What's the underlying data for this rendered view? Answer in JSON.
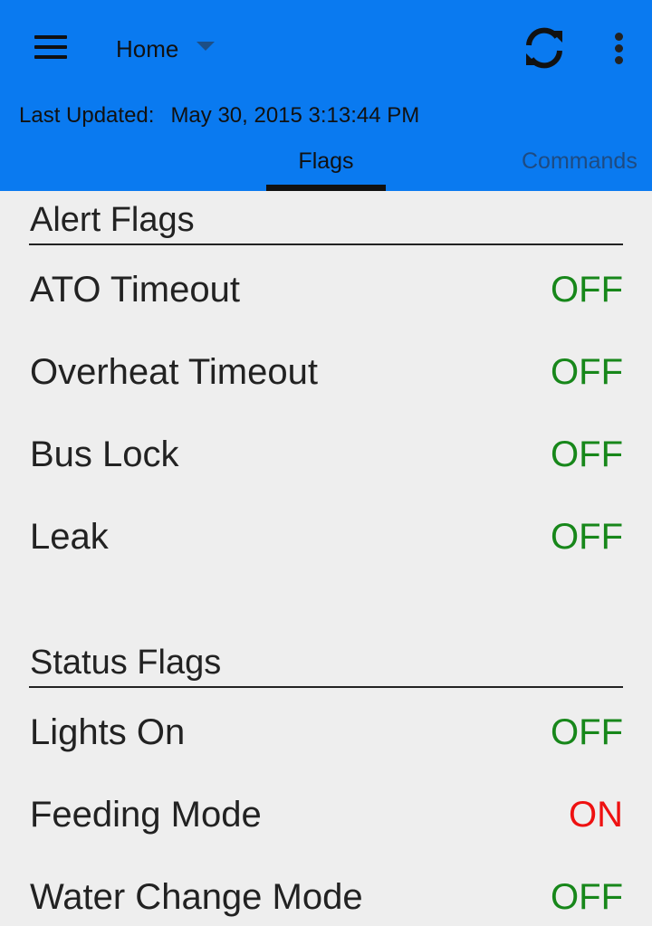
{
  "header": {
    "location": "Home",
    "last_updated_label": "Last Updated:",
    "last_updated_value": "May 30, 2015 3:13:44 PM",
    "icons": {
      "menu": "hamburger-menu-icon",
      "refresh": "refresh-icon",
      "overflow": "more-vert-icon",
      "dropdown": "chevron-down-icon"
    }
  },
  "tabs": [
    {
      "label": "Flags",
      "selected": true
    },
    {
      "label": "Commands",
      "selected": false
    }
  ],
  "alert_flags": {
    "title": "Alert Flags",
    "items": [
      {
        "label": "ATO Timeout",
        "value": "OFF"
      },
      {
        "label": "Overheat Timeout",
        "value": "OFF"
      },
      {
        "label": "Bus Lock",
        "value": "OFF"
      },
      {
        "label": "Leak",
        "value": "OFF"
      }
    ]
  },
  "status_flags": {
    "title": "Status Flags",
    "items": [
      {
        "label": "Lights On",
        "value": "OFF"
      },
      {
        "label": "Feeding Mode",
        "value": "ON"
      },
      {
        "label": "Water Change Mode",
        "value": "OFF"
      }
    ]
  },
  "colors": {
    "appbar": "#0a7af0",
    "off": "#17871a",
    "on": "#ee1111",
    "background": "#eeeeee"
  }
}
